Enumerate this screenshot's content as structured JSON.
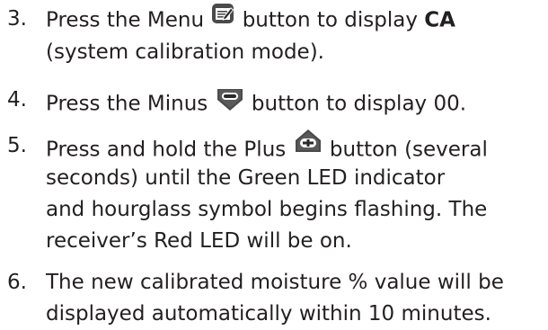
{
  "steps": [
    {
      "number": "3.",
      "line1_before": "Press the Menu",
      "line1_icon": "menu-notepad-icon",
      "line1_after": "button to display",
      "line1_bold": "CA",
      "line2": "(system calibration mode)."
    },
    {
      "number": "4.",
      "line1_before": "Press the Minus",
      "line1_icon": "minus-arrow-down-icon",
      "line1_after": "button to display 00."
    },
    {
      "number": "5.",
      "line1_before": "Press and hold the Plus",
      "line1_icon": "plus-arrow-up-icon",
      "line1_after": "button (several",
      "line2": "seconds) until the Green LED indicator",
      "line3": "and hourglass symbol begins flashing. The",
      "line4": "receiver’s Red LED will be on."
    },
    {
      "number": "6.",
      "line1": "The new calibrated moisture % value will be",
      "line2": "displayed automatically within 10 minutes."
    }
  ],
  "colors": {
    "text": "#231f20",
    "icon_fill": "#4a4a4a",
    "icon_dark": "#2a2a2a"
  }
}
